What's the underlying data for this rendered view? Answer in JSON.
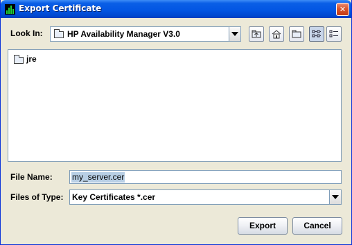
{
  "window": {
    "title": "Export Certificate",
    "app_icon": "chart-bars-icon",
    "close_label": "✕"
  },
  "look_in": {
    "label": "Look In:",
    "value": "HP Availability Manager V3.0",
    "icon": "folder-icon"
  },
  "toolbar": {
    "buttons": [
      {
        "name": "up-one-level-icon"
      },
      {
        "name": "home-icon"
      },
      {
        "name": "new-folder-icon"
      },
      {
        "name": "list-view-icon",
        "active": true
      },
      {
        "name": "details-view-icon"
      }
    ]
  },
  "files": [
    {
      "name": "jre",
      "icon": "folder-icon"
    }
  ],
  "file_name": {
    "label": "File Name:",
    "value": "my_server.cer"
  },
  "file_type": {
    "label": "Files of Type:",
    "value": "Key Certificates *.cer"
  },
  "buttons": {
    "export": "Export",
    "cancel": "Cancel"
  },
  "colors": {
    "titlebar": "#0356e3",
    "dialog_bg": "#ece9d8",
    "selection": "#b8cfe5",
    "border": "#7f9db9"
  }
}
